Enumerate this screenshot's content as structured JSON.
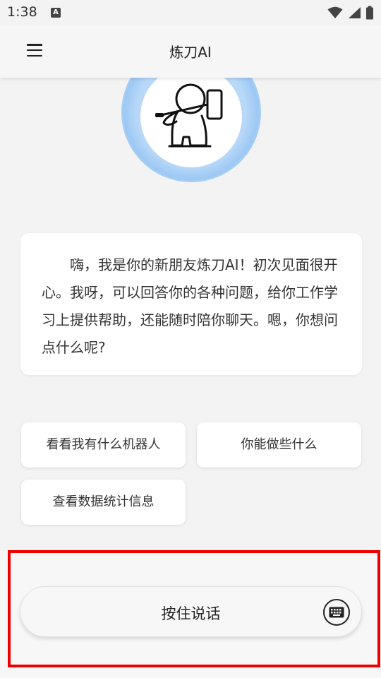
{
  "status_bar": {
    "time": "1:38",
    "notification_icon_letter": "A"
  },
  "app_bar": {
    "title": "炼刀AI"
  },
  "intro": {
    "text": "嗨，我是你的新朋友炼刀AI！初次见面很开心。我呀，可以回答你的各种问题，给你工作学习上提供帮助，还能随时陪你聊天。嗯，你想问点什么呢?"
  },
  "suggestions": [
    {
      "label": "看看我有什么机器人"
    },
    {
      "label": "你能做些什么"
    },
    {
      "label": "查看数据统计信息"
    }
  ],
  "input_bar": {
    "hold_to_talk_label": "按住说话"
  },
  "colors": {
    "highlight": "#ee0000",
    "glow": "#9cc8f4",
    "background": "#f3f3f3"
  }
}
